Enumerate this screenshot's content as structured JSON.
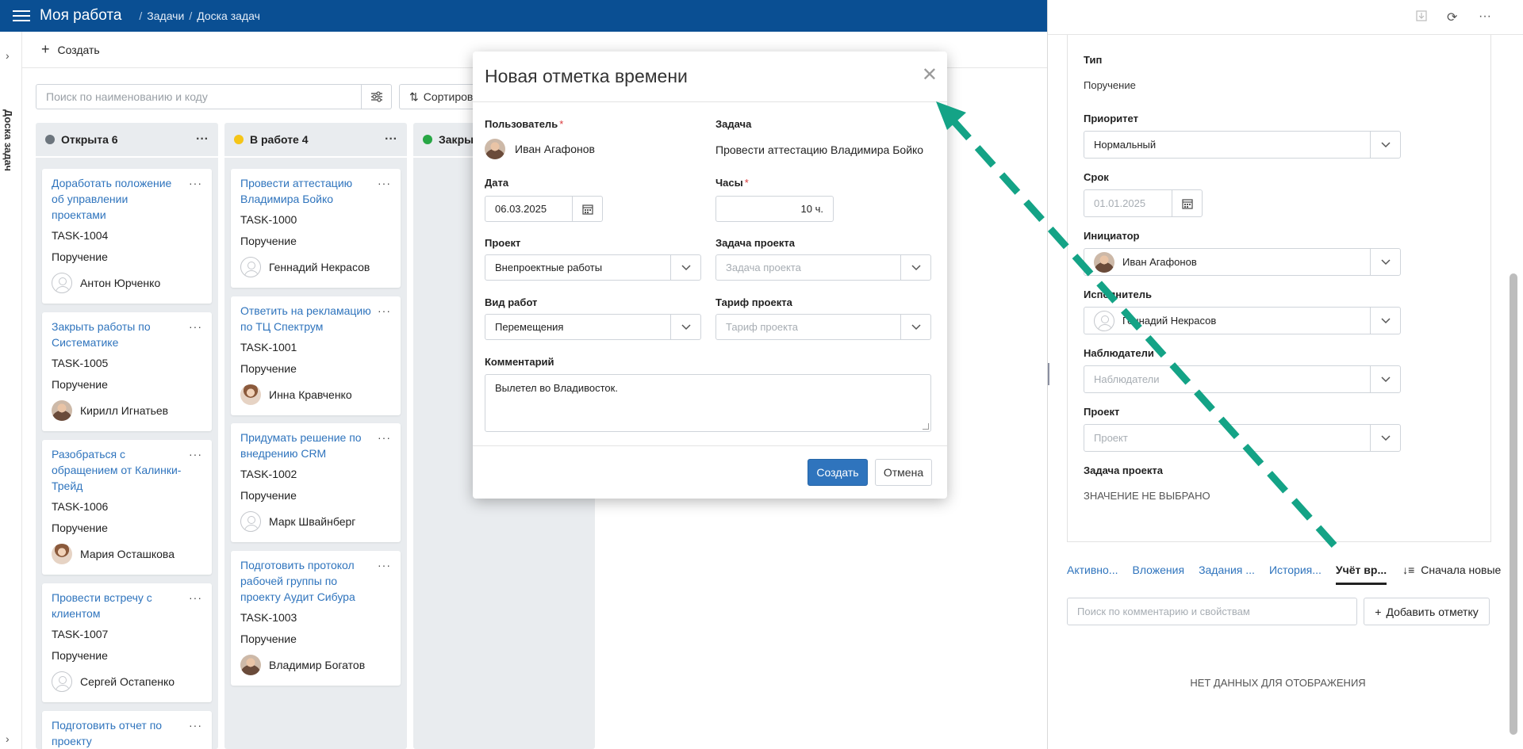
{
  "header": {
    "app_title": "Моя работа",
    "crumb_sep": "/",
    "crumbs": [
      "Задачи",
      "Доска задач"
    ]
  },
  "rail": {
    "vertical_title": "Доска задач"
  },
  "toolbar": {
    "create_label": "Создать",
    "search_placeholder": "Поиск по наименованию и коду",
    "sort_label": "Сортиров"
  },
  "columns": [
    {
      "title": "Открыта 6",
      "status_color": "#6c757d",
      "cards": [
        {
          "title": "Доработать положение об управлении проектами",
          "code": "TASK-1004",
          "type": "Поручение",
          "person": "Антон Юрченко"
        },
        {
          "title": "Закрыть работы по Систематике",
          "code": "TASK-1005",
          "type": "Поручение",
          "person": "Кирилл Игнатьев"
        },
        {
          "title": "Разобраться с обращением от Калинки-Трейд",
          "code": "TASK-1006",
          "type": "Поручение",
          "person": "Мария Осташкова"
        },
        {
          "title": "Провести встречу с клиентом",
          "code": "TASK-1007",
          "type": "Поручение",
          "person": "Сергей Остапенко"
        },
        {
          "title": "Подготовить отчет по проекту"
        }
      ]
    },
    {
      "title": "В работе 4",
      "status_color": "#f5c518",
      "cards": [
        {
          "title": "Провести аттестацию Владимира Бойко",
          "code": "TASK-1000",
          "type": "Поручение",
          "person": "Геннадий Некрасов"
        },
        {
          "title": "Ответить на рекламацию по ТЦ Спектрум",
          "code": "TASK-1001",
          "type": "Поручение",
          "person": "Инна Кравченко"
        },
        {
          "title": "Придумать решение по внедрению CRM",
          "code": "TASK-1002",
          "type": "Поручение",
          "person": "Марк Швайнберг"
        },
        {
          "title": "Подготовить протокол рабочей группы по проекту Аудит Сибура",
          "code": "TASK-1003",
          "type": "Поручение",
          "person": "Владимир Богатов"
        }
      ]
    },
    {
      "title": "Закры",
      "status_color": "#28a745",
      "cards": []
    }
  ],
  "modal": {
    "title": "Новая отметка времени",
    "user_label": "Пользователь",
    "user_value": "Иван Агафонов",
    "task_label": "Задача",
    "task_value": "Провести аттестацию Владимира Бойко",
    "date_label": "Дата",
    "date_value": "06.03.2025",
    "hours_label": "Часы",
    "hours_value": "10 ч.",
    "project_label": "Проект",
    "project_value": "Внепроектные работы",
    "project_task_label": "Задача проекта",
    "project_task_placeholder": "Задача проекта",
    "work_type_label": "Вид работ",
    "work_type_value": "Перемещения",
    "tariff_label": "Тариф проекта",
    "tariff_placeholder": "Тариф проекта",
    "comment_label": "Комментарий",
    "comment_value": "Вылетел во Владивосток.",
    "create_button": "Создать",
    "cancel_button": "Отмена",
    "required_mark": "*"
  },
  "panel": {
    "type_label": "Тип",
    "type_value": "Поручение",
    "priority_label": "Приоритет",
    "priority_value": "Нормальный",
    "due_label": "Срок",
    "due_placeholder": "01.01.2025",
    "initiator_label": "Инициатор",
    "initiator_value": "Иван Агафонов",
    "executor_label": "Исполнитель",
    "executor_value": "Геннадий Некрасов",
    "observers_label": "Наблюдатели",
    "observers_placeholder": "Наблюдатели",
    "project_label": "Проект",
    "project_placeholder": "Проект",
    "project_task_label": "Задача проекта",
    "project_task_value": "ЗНАЧЕНИЕ НЕ ВЫБРАНО",
    "tabs": [
      "Активно...",
      "Вложения",
      "Задания ...",
      "История...",
      "Учёт вр..."
    ],
    "active_tab_index": 4,
    "sort_label": "Сначала новые",
    "search_placeholder": "Поиск по комментарию и свойствам",
    "add_mark_label": "Добавить отметку",
    "no_data": "НЕТ ДАННЫХ ДЛЯ ОТОБРАЖЕНИЯ"
  },
  "annotation": {
    "arrow_color": "#14a386"
  }
}
